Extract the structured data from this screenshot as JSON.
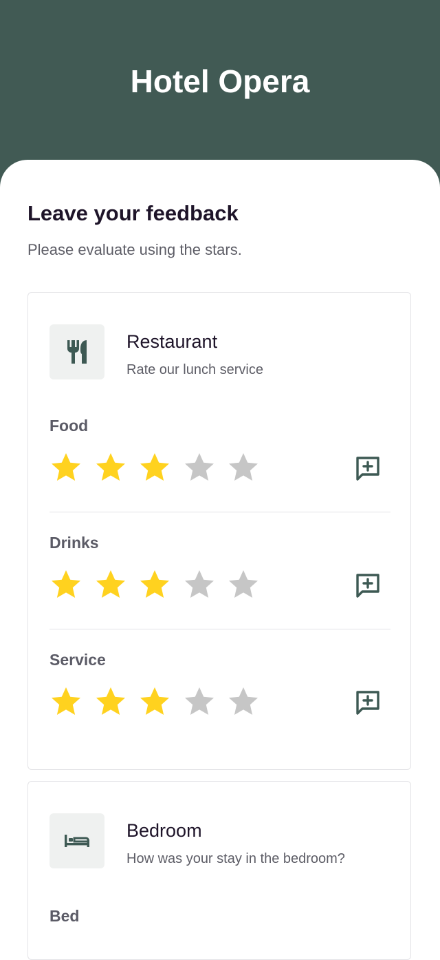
{
  "header": {
    "title": "Hotel Opera",
    "background_color": "#415a54"
  },
  "page": {
    "heading": "Leave your feedback",
    "subtitle": "Please evaluate using the stars."
  },
  "colors": {
    "star_filled": "#ffd21f",
    "star_empty": "#c6c6c6",
    "icon": "#3d5953"
  },
  "cards": [
    {
      "title": "Restaurant",
      "description": "Rate our lunch service",
      "icon": "fork-knife-icon",
      "rows": [
        {
          "label": "Food",
          "rating": 3,
          "max": 5,
          "comment_icon": "add-comment-icon"
        },
        {
          "label": "Drinks",
          "rating": 3,
          "max": 5,
          "comment_icon": "add-comment-icon"
        },
        {
          "label": "Service",
          "rating": 3,
          "max": 5,
          "comment_icon": "add-comment-icon"
        }
      ]
    },
    {
      "title": "Bedroom",
      "description": "How was your stay in the bedroom?",
      "icon": "bed-icon",
      "rows": [
        {
          "label": "Bed"
        }
      ]
    }
  ]
}
